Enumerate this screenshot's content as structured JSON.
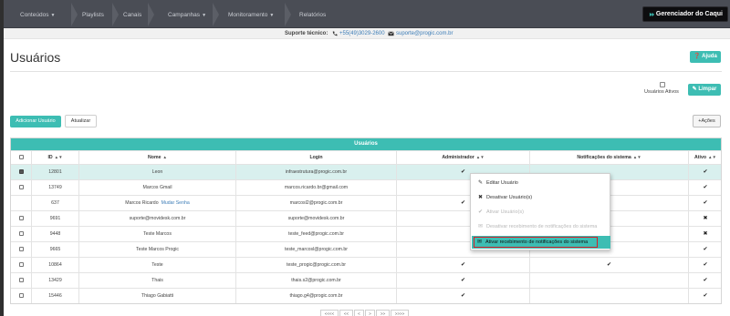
{
  "nav": {
    "items": [
      {
        "label": "Conteúdos",
        "caret": true
      },
      {
        "label": "Playlists",
        "caret": false
      },
      {
        "label": "Canais",
        "caret": false
      },
      {
        "label": "Campanhas",
        "caret": true
      },
      {
        "label": "Monitoramento",
        "caret": true
      },
      {
        "label": "Relatórios",
        "caret": false
      }
    ],
    "brand_label": "Gerenciador do Caqui"
  },
  "support": {
    "label": "Suporte técnico:",
    "phone": "+55(49)3029-2600",
    "email": "suporte@progic.com.br"
  },
  "page": {
    "title": "Usuários",
    "help_label": "Ajuda",
    "active_filter_label": "Usuários Ativos",
    "clear_label": "Limpar",
    "add_user_label": "Adicionar Usuário",
    "refresh_label": "Atualizar",
    "actions_label": "Ações"
  },
  "table": {
    "caption": "Usuários",
    "headers": {
      "id": "ID",
      "name": "Nome",
      "login": "Login",
      "admin": "Administrador",
      "notifications": "Notificações do sistema",
      "active": "Ativo"
    },
    "rows": [
      {
        "id": "12801",
        "name": "Leon",
        "extra": "",
        "login": "infraestrutura@progic.com.br",
        "admin": "✔",
        "notif": "",
        "active": "✔",
        "checkbox": true,
        "checked": true
      },
      {
        "id": "13749",
        "name": "Marcos Gmail",
        "extra": "",
        "login": "marcos.ricardo.br@gmail.com",
        "admin": "",
        "notif": "",
        "active": "✔",
        "checkbox": true,
        "checked": false
      },
      {
        "id": "637",
        "name": "Marcos Ricardo",
        "extra": "Mudar Senha",
        "login": "marcosl2@progic.com.br",
        "admin": "✔",
        "notif": "",
        "active": "✔",
        "checkbox": false,
        "checked": false
      },
      {
        "id": "9691",
        "name": "suporte@movidesk.com.br",
        "extra": "",
        "login": "suporte@movidesk.com.br",
        "admin": "",
        "notif": "",
        "active": "✖",
        "checkbox": true,
        "checked": false
      },
      {
        "id": "9448",
        "name": "Teste Marcos",
        "extra": "",
        "login": "teste_feed@progic.com.br",
        "admin": "",
        "notif": "",
        "active": "✖",
        "checkbox": true,
        "checked": false
      },
      {
        "id": "9665",
        "name": "Teste Marcos Progic",
        "extra": "",
        "login": "teste_marcosl@progic.com.br",
        "admin": "",
        "notif": "",
        "active": "✔",
        "checkbox": true,
        "checked": false
      },
      {
        "id": "10864",
        "name": "Teste",
        "extra": "",
        "login": "teste_progic@progic.com.br",
        "admin": "✔",
        "notif": "✔",
        "active": "✔",
        "checkbox": true,
        "checked": false
      },
      {
        "id": "13429",
        "name": "Thais",
        "extra": "",
        "login": "thais.s2@progic.com.br",
        "admin": "✔",
        "notif": "",
        "active": "✔",
        "checkbox": true,
        "checked": false
      },
      {
        "id": "15446",
        "name": "Thiago Gabiatti",
        "extra": "",
        "login": "thiago.g4@progic.com.br",
        "admin": "✔",
        "notif": "",
        "active": "✔",
        "checkbox": true,
        "checked": false
      }
    ]
  },
  "context_menu": {
    "items": [
      {
        "label": "Editar Usuário",
        "icon": "edit-icon",
        "glyph": "✎",
        "disabled": false
      },
      {
        "label": "Desativar Usuário(s)",
        "icon": "close-icon",
        "glyph": "✖",
        "disabled": false
      },
      {
        "label": "Ativar Usuário(s)",
        "icon": "check-icon",
        "glyph": "✔",
        "disabled": true
      },
      {
        "label": "Desativar recebimento de notificações do sistema",
        "icon": "envelope-off-icon",
        "glyph": "✉",
        "disabled": true
      },
      {
        "label": "Ativar recebimento de notificações do sistema",
        "icon": "envelope-icon",
        "glyph": "✉",
        "disabled": false
      }
    ]
  },
  "pager": {
    "items": [
      "<<<<",
      "<<",
      "<",
      ">",
      ">>",
      ">>>>"
    ]
  },
  "colors": {
    "accent": "#3dbdb3",
    "nav_bg": "#4a4d55",
    "selected_row": "#d9f0ee",
    "highlight_border": "#d4202a",
    "link": "#3d7db7"
  }
}
